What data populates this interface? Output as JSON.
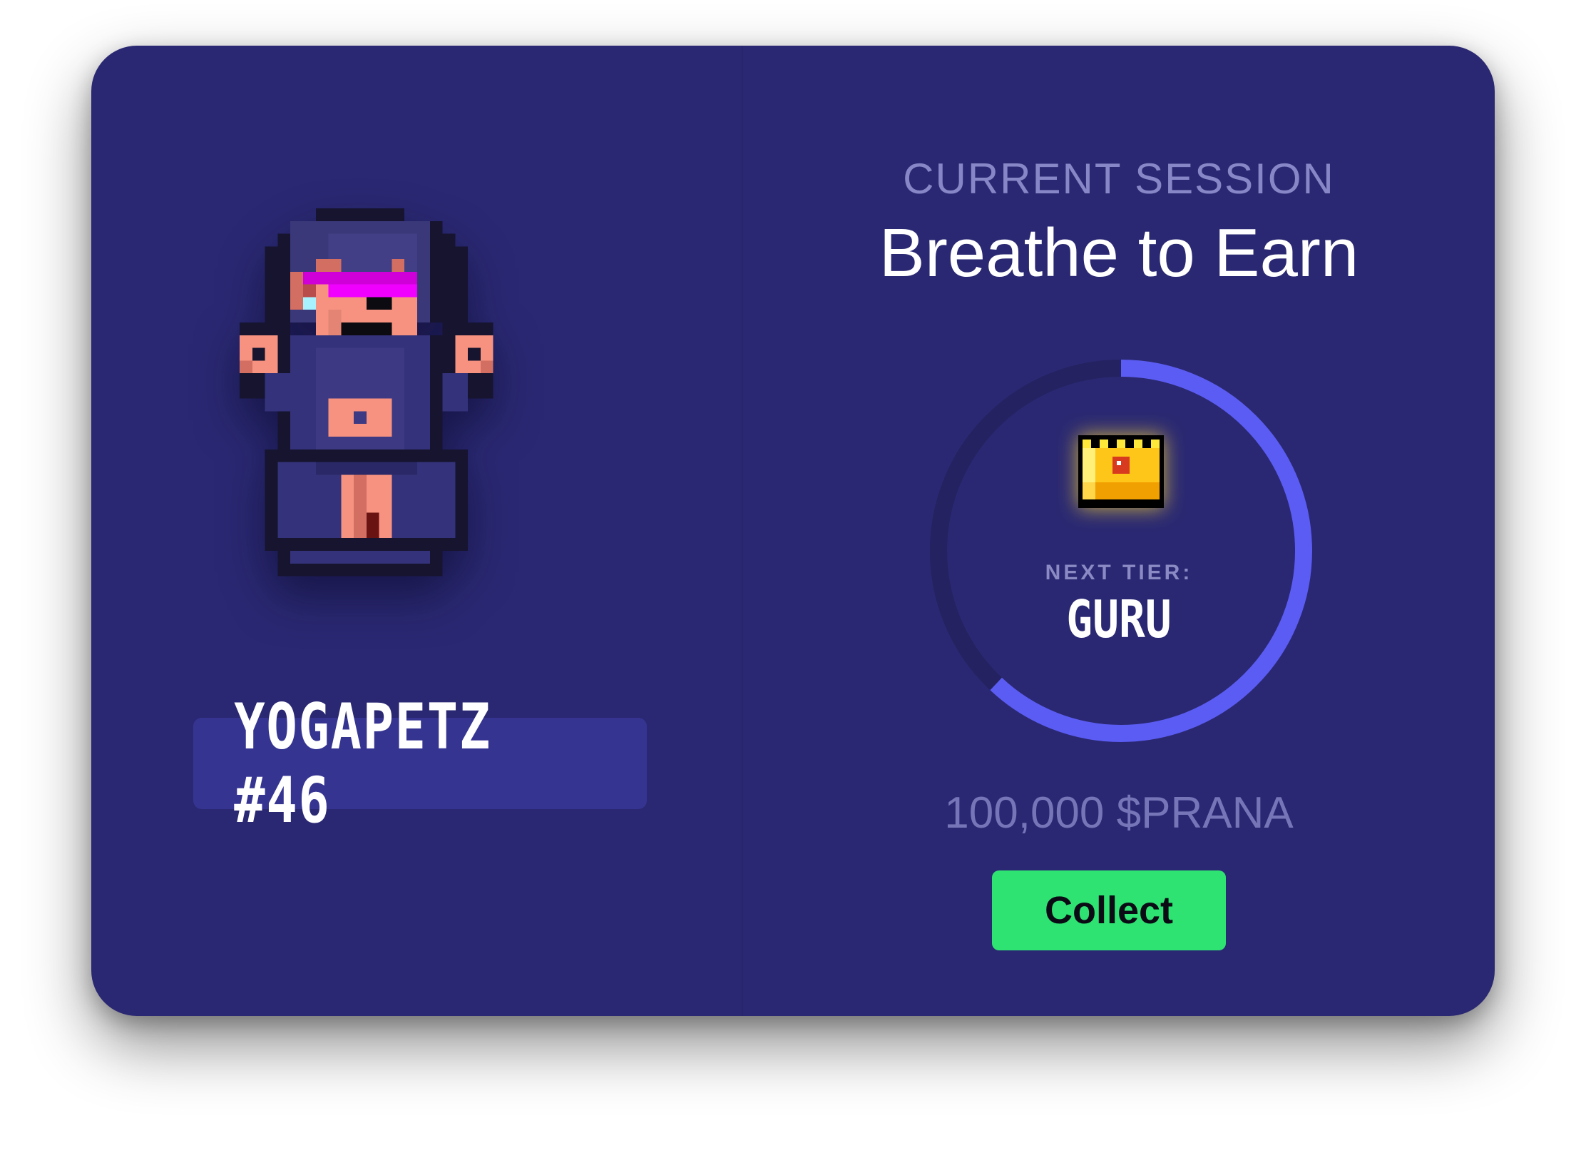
{
  "card": {
    "nft_name": "YOGAPETZ #46",
    "session_label": "CURRENT SESSION",
    "session_title": "Breathe to Earn",
    "next_tier_label": "NEXT TIER:",
    "next_tier_name": "GURU",
    "amount": "100,000 $PRANA",
    "collect_label": "Collect",
    "progress": 0.62
  },
  "colors": {
    "card_background": "#2a2872",
    "badge_background": "#353491",
    "ring_track": "#242260",
    "ring_progress": "#5b5cf3",
    "collect_button": "#2fe372"
  },
  "icons": {
    "avatar": "pixel-monkey-avatar",
    "tier": "crown-icon"
  }
}
